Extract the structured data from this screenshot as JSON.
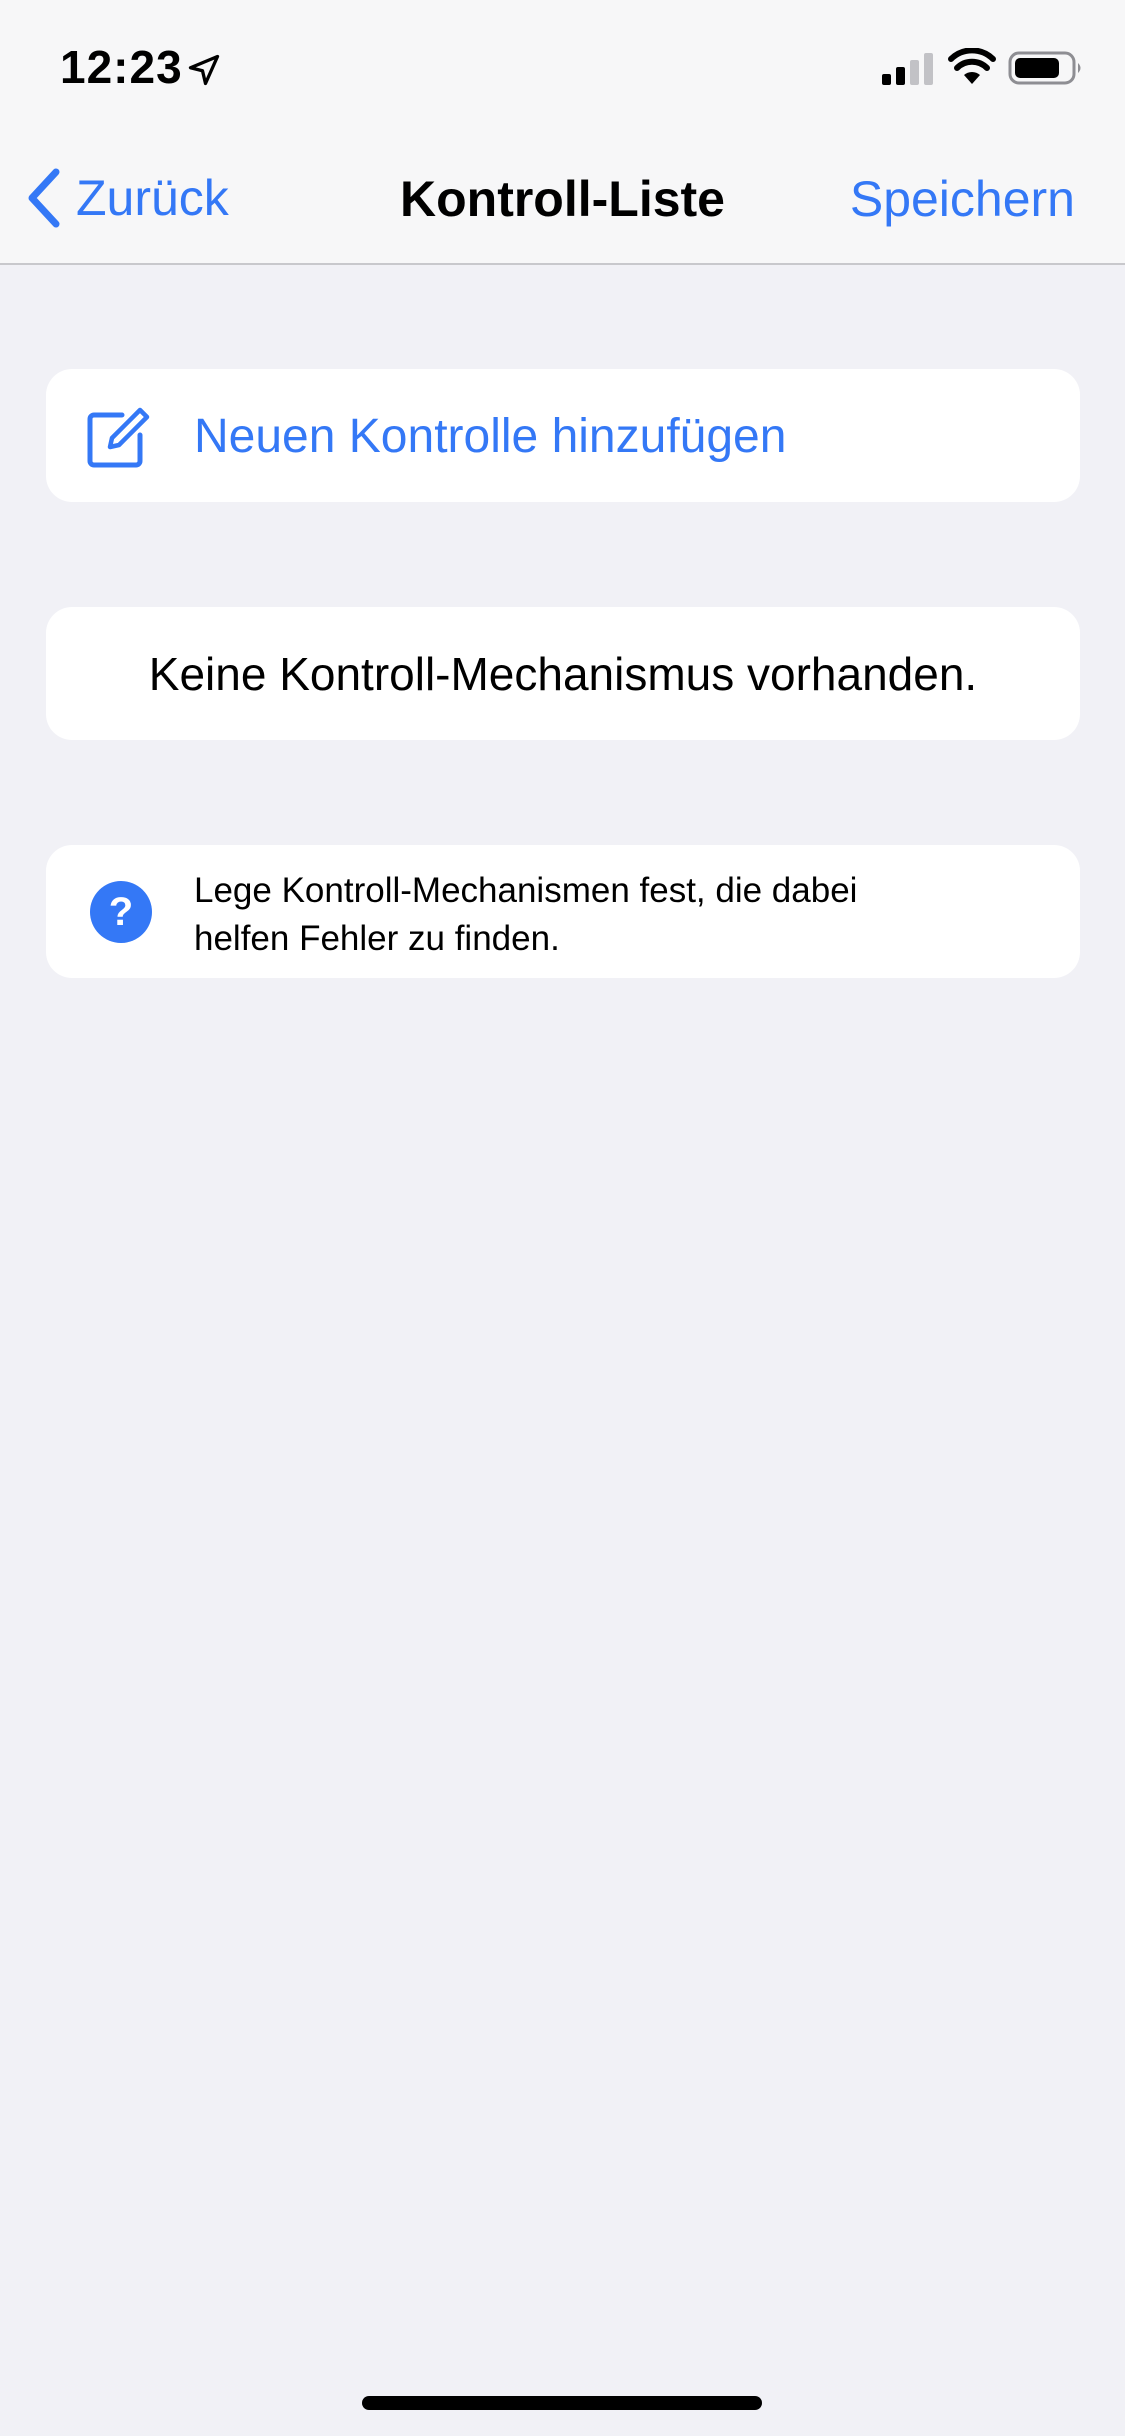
{
  "status_bar": {
    "time": "12:23",
    "icons": [
      "location-arrow-icon",
      "cellular-signal-icon",
      "wifi-icon",
      "battery-icon"
    ]
  },
  "nav": {
    "back_label": "Zurück",
    "title": "Kontroll-Liste",
    "save_label": "Speichern"
  },
  "add_card": {
    "icon": "compose-icon",
    "label": "Neuen Kontrolle hinzufügen"
  },
  "empty_card": {
    "label": "Keine Kontroll-Mechanismus vorhanden."
  },
  "info_card": {
    "icon": "question-icon",
    "icon_glyph": "?",
    "text_line1": "Lege Kontroll-Mechanismen fest, die dabei",
    "text_line2": "helfen Fehler zu finden."
  },
  "colors": {
    "accent": "#3478f6",
    "background": "#f1f1f6",
    "card": "#ffffff"
  }
}
